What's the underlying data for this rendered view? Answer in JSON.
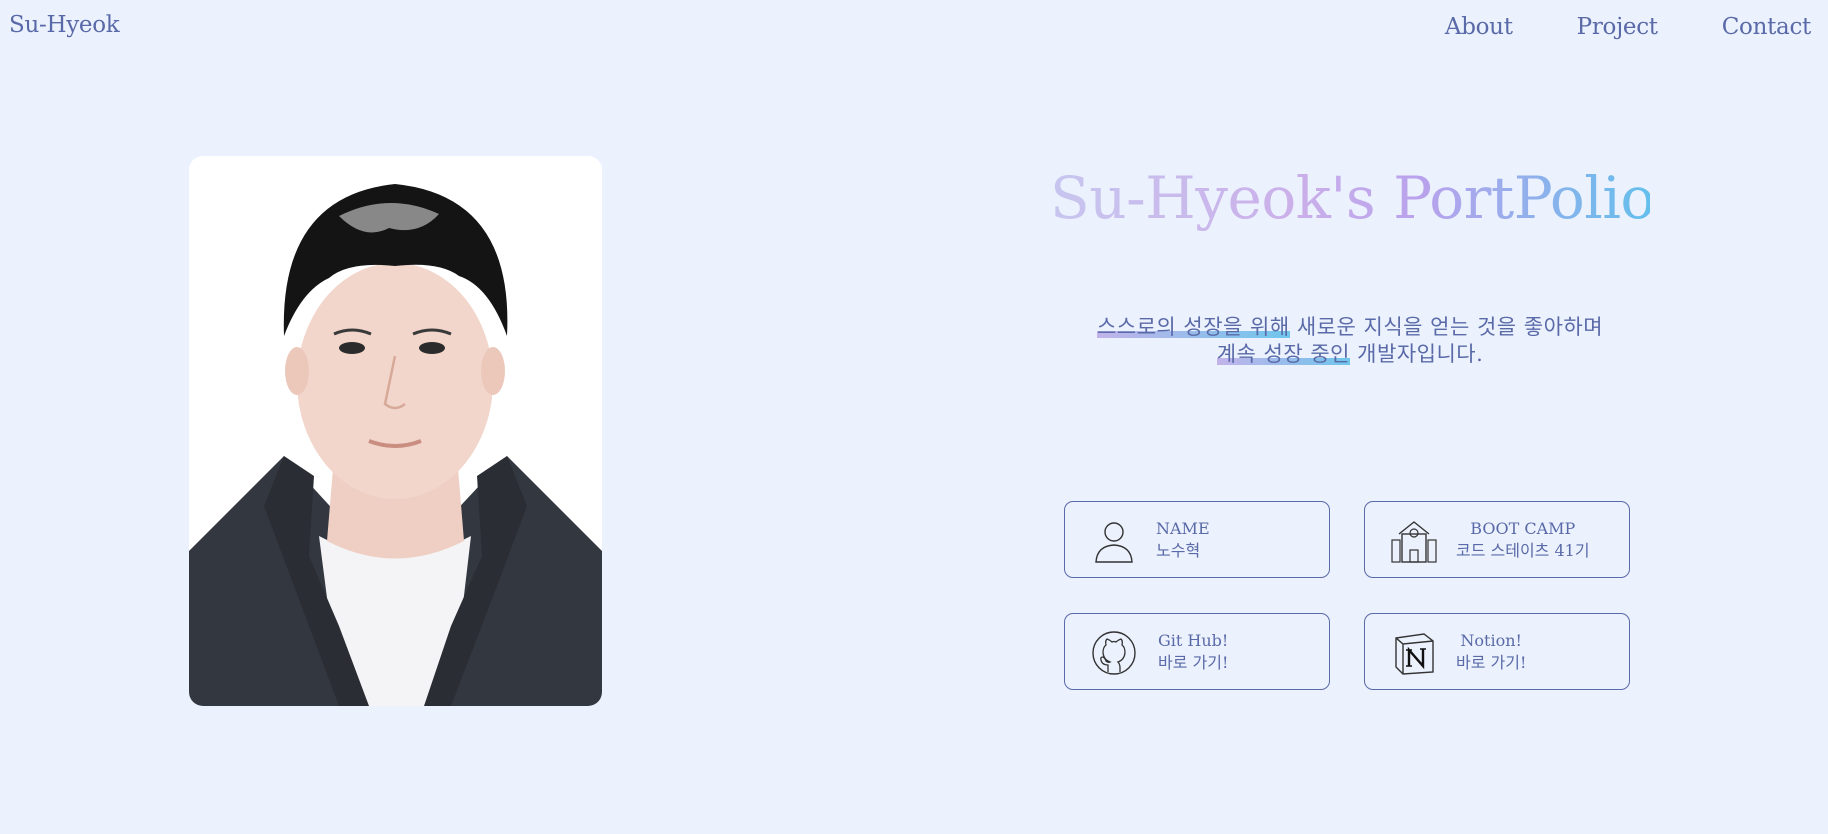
{
  "header": {
    "brand": "Su-Hyeok",
    "nav": [
      {
        "label": "About"
      },
      {
        "label": "Project"
      },
      {
        "label": "Contact"
      }
    ]
  },
  "hero": {
    "title": "Su-Hyeok's PortPolio",
    "intro": {
      "line1_highlight": "스스로의 성장을 위해",
      "line1_rest": " 새로운 지식을 얻는 것을 좋아하며",
      "line2_highlight": "계속 성장 중인",
      "line2_rest": " 개발자입니다."
    }
  },
  "cards": [
    {
      "icon": "person-icon",
      "title": "NAME",
      "value": "노수혁"
    },
    {
      "icon": "school-icon",
      "title": "BOOT CAMP",
      "value": "코드 스테이츠 41기"
    },
    {
      "icon": "github-icon",
      "title": "Git Hub!",
      "value": "바로 가기!"
    },
    {
      "icon": "notion-icon",
      "title": "Notion!",
      "value": "바로 가기!"
    }
  ],
  "colors": {
    "background": "#ebf1fd",
    "text": "#5a6aa8",
    "gradient_start": "#c7c6ef",
    "gradient_end": "#64bfec"
  }
}
